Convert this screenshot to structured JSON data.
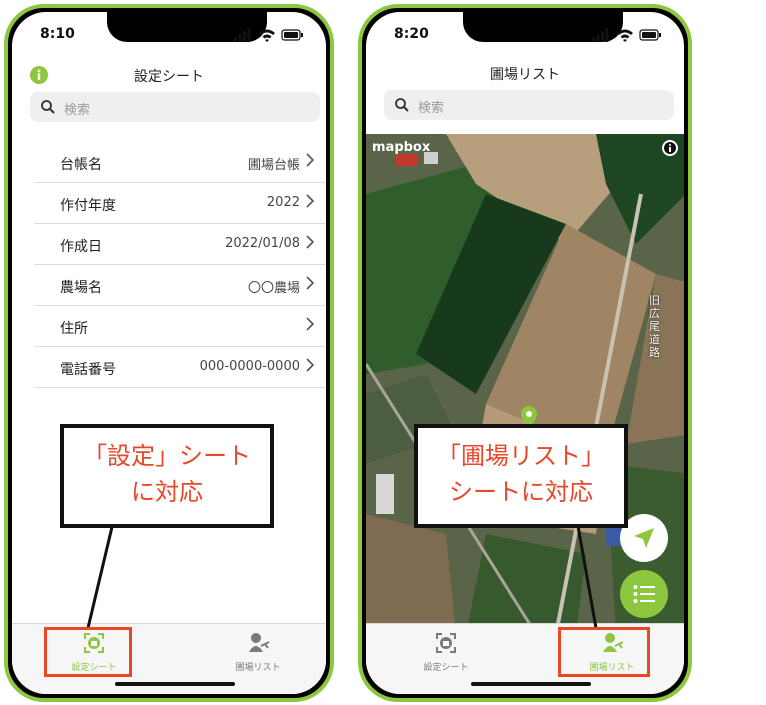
{
  "left": {
    "status_time": "8:10",
    "title": "設定シート",
    "search_placeholder": "検索",
    "rows": [
      {
        "label": "台帳名",
        "value": "圃場台帳"
      },
      {
        "label": "作付年度",
        "value": "2022"
      },
      {
        "label": "作成日",
        "value": "2022/01/08"
      },
      {
        "label": "農場名",
        "value": "〇〇農場"
      },
      {
        "label": "住所",
        "value": ""
      },
      {
        "label": "電話番号",
        "value": "000-0000-0000"
      }
    ],
    "tabs": [
      {
        "label": "設定シート",
        "active": true
      },
      {
        "label": "圃場リスト",
        "active": false
      }
    ],
    "callout_lines": [
      "「設定」シート",
      "に対応"
    ]
  },
  "right": {
    "status_time": "8:20",
    "title": "圃場リスト",
    "search_placeholder": "検索",
    "map_attribution": "mapbox",
    "road_label": "旧広尾道路",
    "tabs": [
      {
        "label": "設定シート",
        "active": false
      },
      {
        "label": "圃場リスト",
        "active": true
      }
    ],
    "callout_lines": [
      "「圃場リスト」",
      "シートに対応"
    ]
  },
  "colors": {
    "accent_green": "#8dc63f",
    "callout_red": "#e8472a",
    "inactive_gray": "#7a7a7a"
  },
  "icons": {
    "info": "info-icon",
    "search": "search-icon",
    "chevron": "chevron-right-icon",
    "settings_tab": "settings-sheet-icon",
    "field_tab": "field-list-icon",
    "locate": "location-arrow-icon",
    "list": "list-icon"
  }
}
